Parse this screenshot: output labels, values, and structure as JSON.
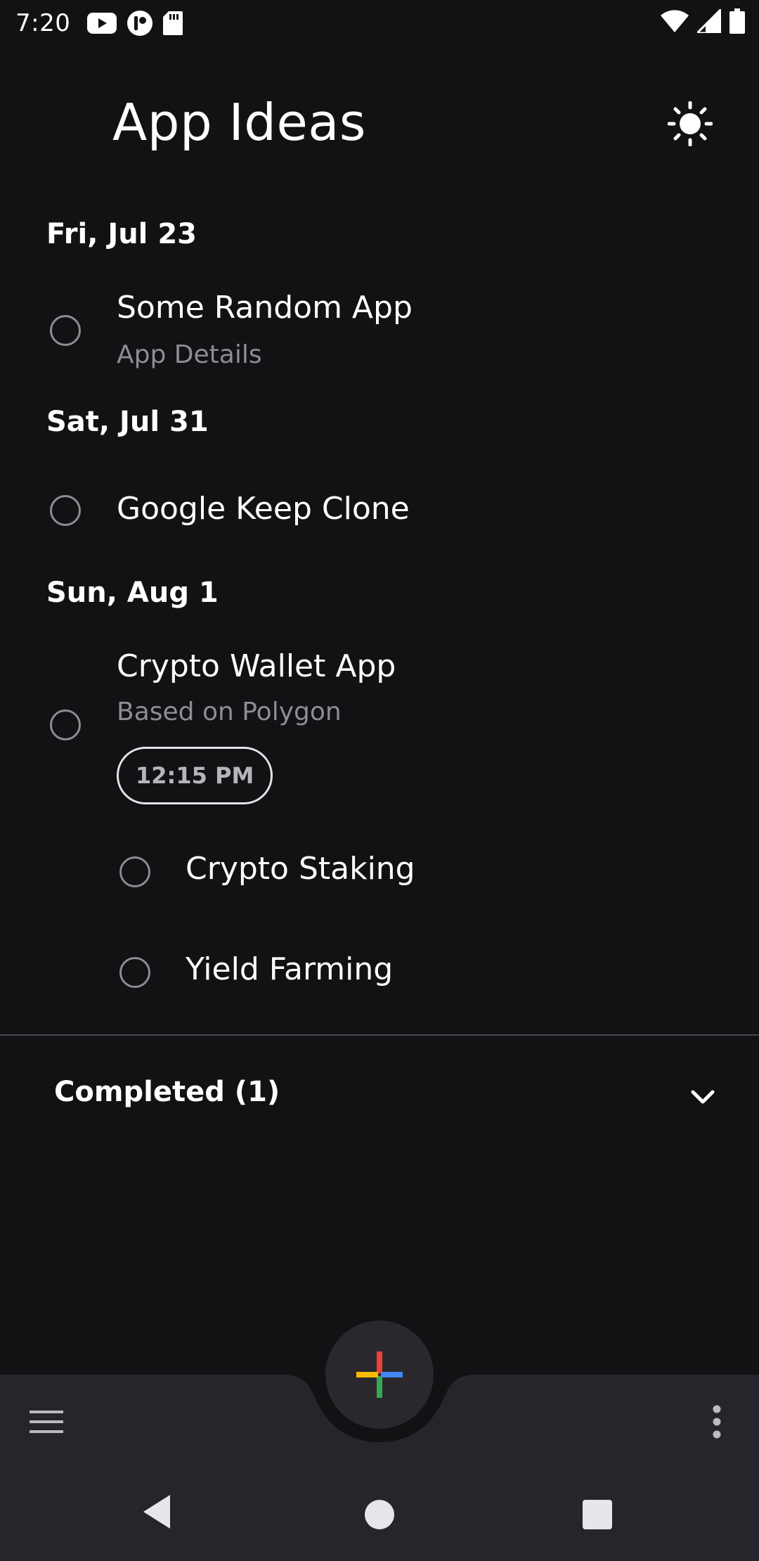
{
  "status_bar": {
    "time": "7:20",
    "left_icons": [
      "youtube-icon",
      "app-icon",
      "sd-card-icon"
    ],
    "right_icons": [
      "wifi-icon",
      "signal-icon",
      "battery-icon"
    ]
  },
  "header": {
    "title": "App Ideas",
    "theme_icon": "sun-icon"
  },
  "groups": [
    {
      "date": "Fri, Jul 23",
      "tasks": [
        {
          "title": "Some Random App",
          "details": "App Details"
        }
      ]
    },
    {
      "date": "Sat, Jul 31",
      "tasks": [
        {
          "title": "Google Keep Clone"
        }
      ]
    },
    {
      "date": "Sun, Aug 1",
      "tasks": [
        {
          "title": "Crypto Wallet App",
          "details": "Based on Polygon",
          "time": "12:15 PM",
          "subtasks": [
            {
              "title": "Crypto Staking"
            },
            {
              "title": "Yield Farming"
            }
          ]
        }
      ]
    }
  ],
  "completed": {
    "label": "Completed (1)",
    "icon": "chevron-down-icon"
  },
  "bottom_bar": {
    "menu_icon": "menu-icon",
    "fab_icon": "plus-icon",
    "more_icon": "more-vert-icon"
  },
  "nav_bar": {
    "back_icon": "back-icon",
    "home_icon": "home-icon",
    "recents_icon": "recents-icon"
  },
  "colors": {
    "background": "#121113",
    "bottom_bar": "#27252b",
    "text_secondary": "#8f8c93",
    "plus_red": "#ea4335",
    "plus_blue": "#4285f4",
    "plus_green": "#34a853",
    "plus_yellow": "#fbbc05"
  }
}
